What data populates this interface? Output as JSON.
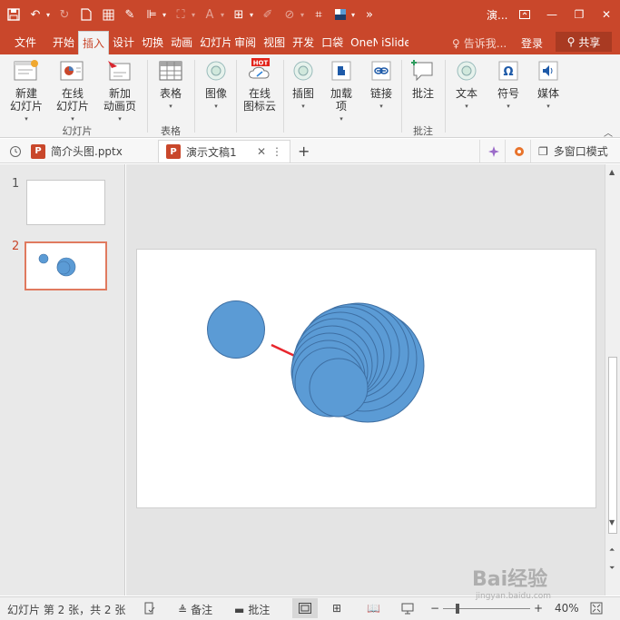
{
  "app": {
    "title_truncated": "演...",
    "accent_color": "#c9472b"
  },
  "ribbon_tabs": [
    {
      "label": "文件"
    },
    {
      "label": "开始"
    },
    {
      "label": "插入"
    },
    {
      "label": "设计"
    },
    {
      "label": "切换"
    },
    {
      "label": "动画"
    },
    {
      "label": "幻灯片"
    },
    {
      "label": "审阅"
    },
    {
      "label": "视图"
    },
    {
      "label": "开发"
    },
    {
      "label": "口袋"
    },
    {
      "label": "OneN"
    },
    {
      "label": "iSlide"
    }
  ],
  "tell_me": "告诉我...",
  "login": "登录",
  "share": "共享",
  "ribbon": {
    "slides_group": {
      "label": "幻灯片",
      "new_slide": "新建\n幻灯片",
      "online_slide": "在线\n幻灯片",
      "new_anim_page": "新加\n动画页"
    },
    "table_group": {
      "label": "表格",
      "table": "表格"
    },
    "image": "图像",
    "online_icon_cloud": "在线\n图标云",
    "hot_badge": "HOT",
    "illustrations": "插图",
    "addins": "加载\n项",
    "links": "链接",
    "comments_group": {
      "label": "批注",
      "comment": "批注"
    },
    "text": "文本",
    "symbols": "符号",
    "media": "媒体"
  },
  "doc_tabs": {
    "tab1": "简介头图.pptx",
    "tab2": "演示文稿1",
    "multi_window": "多窗口模式"
  },
  "thumbnails": [
    {
      "number": "1"
    },
    {
      "number": "2"
    }
  ],
  "statusbar": {
    "slide_info": "幻灯片 第 2 张，共 2 张",
    "notes": "备注",
    "comments": "批注",
    "zoom": "40%"
  },
  "watermark": {
    "text": "Bai经验",
    "url": "jingyan.baidu.com"
  },
  "slide_content": {
    "shape_color": "#5b9bd5",
    "arrow_color": "#e8262d"
  }
}
